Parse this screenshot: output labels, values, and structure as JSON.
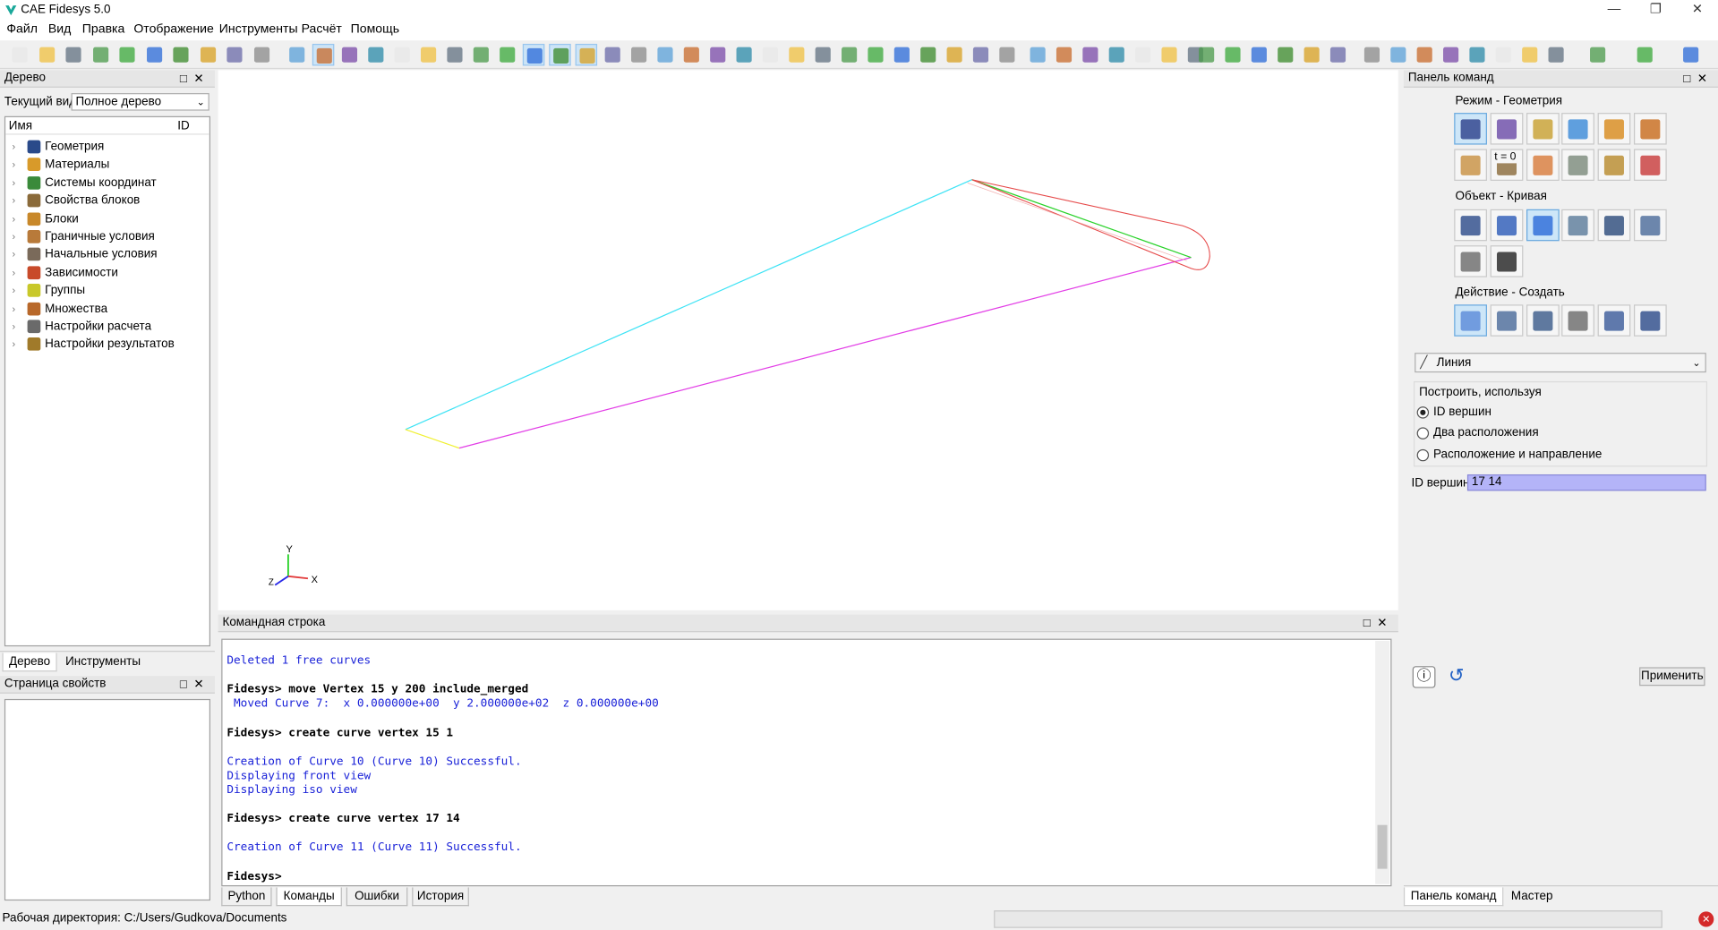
{
  "window": {
    "title": "CAE Fidesys 5.0"
  },
  "menu": [
    "Файл",
    "Вид",
    "Правка",
    "Отображение",
    "Инструменты",
    "Расчёт",
    "Помощь"
  ],
  "tree_panel": {
    "title": "Дерево",
    "view_label": "Текущий вид",
    "view_value": "Полное дерево",
    "col_name": "Имя",
    "col_id": "ID",
    "items": [
      {
        "label": "Геометрия",
        "icon": "geometry-icon",
        "color": "#2a4a8a"
      },
      {
        "label": "Материалы",
        "icon": "materials-icon",
        "color": "#d89a2a"
      },
      {
        "label": "Системы координат",
        "icon": "coordinate-systems-icon",
        "color": "#3a8a3a"
      },
      {
        "label": "Свойства блоков",
        "icon": "block-properties-icon",
        "color": "#8a6a3a"
      },
      {
        "label": "Блоки",
        "icon": "blocks-icon",
        "color": "#c8882a"
      },
      {
        "label": "Граничные условия",
        "icon": "boundary-conditions-icon",
        "color": "#b87a3a"
      },
      {
        "label": "Начальные условия",
        "icon": "initial-conditions-icon",
        "color": "#7a6a5a"
      },
      {
        "label": "Зависимости",
        "icon": "dependencies-icon",
        "color": "#c84a2a"
      },
      {
        "label": "Группы",
        "icon": "groups-icon",
        "color": "#c8c82a"
      },
      {
        "label": "Множества",
        "icon": "sets-icon",
        "color": "#b8682a"
      },
      {
        "label": "Настройки расчета",
        "icon": "calc-settings-icon",
        "color": "#6a6a6a"
      },
      {
        "label": "Настройки результатов",
        "icon": "results-settings-icon",
        "color": "#a07a2a"
      }
    ],
    "tabs": [
      "Дерево",
      "Инструменты"
    ]
  },
  "properties_panel": {
    "title": "Страница свойств"
  },
  "viewport": {
    "axis_x": "X",
    "axis_y": "Y",
    "axis_z": "Z",
    "curve_colors": {
      "cyan": "#3de3f5",
      "magenta": "#e23de6",
      "green": "#2ad22a",
      "red": "#e64a4a",
      "yellow": "#f0f030"
    }
  },
  "console": {
    "title": "Командная строка",
    "lines": [
      {
        "text": "Deleted 1 free curves",
        "kind": "out"
      },
      {
        "text": "",
        "kind": "out"
      },
      {
        "text": "Fidesys> move Vertex 15 y 200 include_merged",
        "kind": "cmd"
      },
      {
        "text": " Moved Curve 7:  x 0.000000e+00  y 2.000000e+02  z 0.000000e+00",
        "kind": "out"
      },
      {
        "text": "",
        "kind": "out"
      },
      {
        "text": "Fidesys> create curve vertex 15 1",
        "kind": "cmd"
      },
      {
        "text": "",
        "kind": "out"
      },
      {
        "text": "Creation of Curve 10 (Curve 10) Successful.",
        "kind": "out"
      },
      {
        "text": "Displaying front view",
        "kind": "out"
      },
      {
        "text": "Displaying iso view",
        "kind": "out"
      },
      {
        "text": "",
        "kind": "out"
      },
      {
        "text": "Fidesys> create curve vertex 17 14",
        "kind": "cmd"
      },
      {
        "text": "",
        "kind": "out"
      },
      {
        "text": "Creation of Curve 11 (Curve 11) Successful.",
        "kind": "out"
      },
      {
        "text": "",
        "kind": "out"
      },
      {
        "text": "Fidesys>",
        "kind": "cmd"
      }
    ],
    "tabs": [
      "Python",
      "Команды",
      "Ошибки",
      "История"
    ],
    "active_tab": "Команды"
  },
  "command_panel": {
    "title": "Панель команд",
    "mode_title": "Режим - Геометрия",
    "object_title": "Объект - Кривая",
    "action_title": "Действие - Создать",
    "type_value": "Линия",
    "build_label": "Построить, используя",
    "options": [
      "ID вершин",
      "Два расположения",
      "Расположение и направление"
    ],
    "selected_option": 0,
    "vertex_id_label": "ID вершин",
    "vertex_id_value": "17 14",
    "apply_label": "Применить",
    "tabs": [
      "Панель команд",
      "Мастер"
    ],
    "t0_label": "t = 0"
  },
  "status": {
    "workdir": "Рабочая директория: C:/Users/Gudkova/Documents"
  }
}
